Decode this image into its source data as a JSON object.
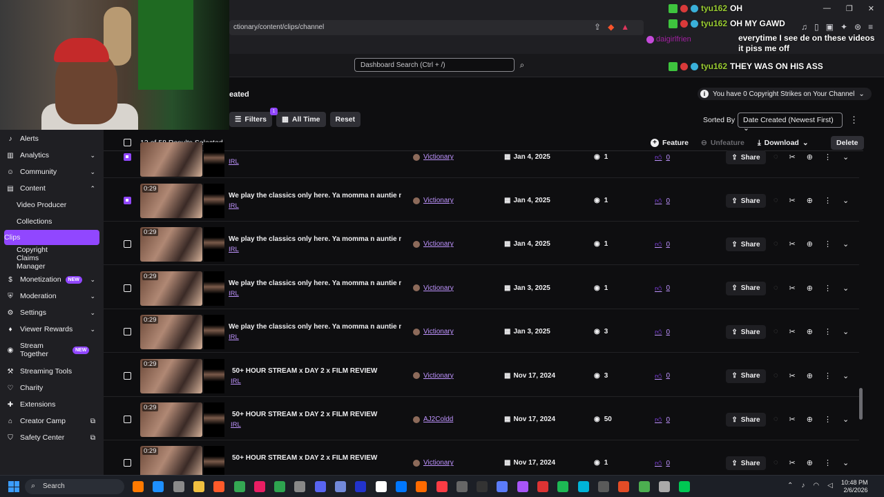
{
  "browser": {
    "url": "ctionary/content/clips/channel"
  },
  "dashboard": {
    "search_placeholder": "Dashboard Search (Ctrl + /)",
    "page_title_fragment": "eated",
    "copyright_strikes": "You have 0 Copyright Strikes on Your Channel"
  },
  "sidebar": {
    "items": [
      {
        "label": "Alerts",
        "icon": "bell-icon"
      },
      {
        "label": "Analytics",
        "icon": "chart-icon"
      },
      {
        "label": "Community",
        "icon": "people-icon"
      },
      {
        "label": "Content",
        "icon": "content-icon"
      },
      {
        "label": "Video Producer"
      },
      {
        "label": "Collections"
      },
      {
        "label": "Clips"
      },
      {
        "label": "Copyright Claims Manager"
      },
      {
        "label": "Monetization",
        "icon": "dollar-icon",
        "badge": "NEW"
      },
      {
        "label": "Moderation",
        "icon": "shield-icon"
      },
      {
        "label": "Settings",
        "icon": "gear-icon"
      },
      {
        "label": "Viewer Rewards",
        "icon": "reward-icon"
      },
      {
        "label": "Stream Together",
        "icon": "stream-icon",
        "badge": "NEW"
      },
      {
        "label": "Streaming Tools",
        "icon": "tools-icon"
      },
      {
        "label": "Charity",
        "icon": "heart-icon"
      },
      {
        "label": "Extensions",
        "icon": "puzzle-icon"
      },
      {
        "label": "Creator Camp",
        "icon": "camp-icon"
      },
      {
        "label": "Safety Center",
        "icon": "safety-icon"
      }
    ]
  },
  "filters": {
    "filters_label": "Filters",
    "filters_count": "1",
    "time_label": "All Time",
    "reset_label": "Reset",
    "sorted_by_label": "Sorted By",
    "sort_value": "Date Created (Newest First)"
  },
  "selection": {
    "text": "13 of 58 Results Selected",
    "feature_label": "Feature",
    "unfeature_label": "Unfeature",
    "download_label": "Download",
    "delete_label": "Delete"
  },
  "row_share_label": "Share",
  "rows": [
    {
      "duration": "",
      "title": "",
      "category": "IRL",
      "creator": "Victionary",
      "date": "Jan 4, 2025",
      "views": "1",
      "likes": "0",
      "checked": true
    },
    {
      "duration": "0:29",
      "title": "We play the classics only here. Ya momma n auntie m...",
      "category": "IRL",
      "creator": "Victionary",
      "date": "Jan 4, 2025",
      "views": "1",
      "likes": "0",
      "checked": true
    },
    {
      "duration": "0:29",
      "title": "We play the classics only here. Ya momma n auntie m...",
      "category": "IRL",
      "creator": "Victionary",
      "date": "Jan 4, 2025",
      "views": "1",
      "likes": "0",
      "checked": false
    },
    {
      "duration": "0:29",
      "title": "We play the classics only here. Ya momma n auntie m...",
      "category": "IRL",
      "creator": "Victionary",
      "date": "Jan 3, 2025",
      "views": "1",
      "likes": "0",
      "checked": false
    },
    {
      "duration": "0:29",
      "title": "We play the classics only here. Ya momma n auntie m...",
      "category": "IRL",
      "creator": "Victionary",
      "date": "Jan 3, 2025",
      "views": "3",
      "likes": "0",
      "checked": false
    },
    {
      "duration": "0:29",
      "title": "50+ HOUR STREAM x DAY 2 x FILM REVIEW",
      "category": "IRL",
      "creator": "Victionary",
      "date": "Nov 17, 2024",
      "views": "3",
      "likes": "0",
      "checked": false
    },
    {
      "duration": "0:29",
      "title": "50+ HOUR STREAM x DAY 2 x FILM REVIEW",
      "category": "IRL",
      "creator": "AJ2Coldd",
      "date": "Nov 17, 2024",
      "views": "50",
      "likes": "0",
      "checked": false
    },
    {
      "duration": "0:29",
      "title": "50+ HOUR STREAM x DAY 2 x FILM REVIEW",
      "category": "",
      "creator": "Victionary",
      "date": "Nov 17, 2024",
      "views": "1",
      "likes": "0",
      "checked": false
    }
  ],
  "chat": [
    {
      "user": "tyu162",
      "message": "OH"
    },
    {
      "user": "tyu162",
      "message": "OH MY GAWD"
    },
    {
      "user": "daigirlfrien",
      "message": "everytime I see de on these videos it piss me off"
    },
    {
      "user": "tyu162",
      "message": "THEY WAS ON HIS ASS"
    }
  ],
  "taskbar": {
    "search_label": "Search",
    "time": "10:48 PM",
    "date": "2/6/2026"
  },
  "colors": {
    "accent": "#9147ff",
    "link": "#bf94ff",
    "bg": "#0e0e10"
  }
}
